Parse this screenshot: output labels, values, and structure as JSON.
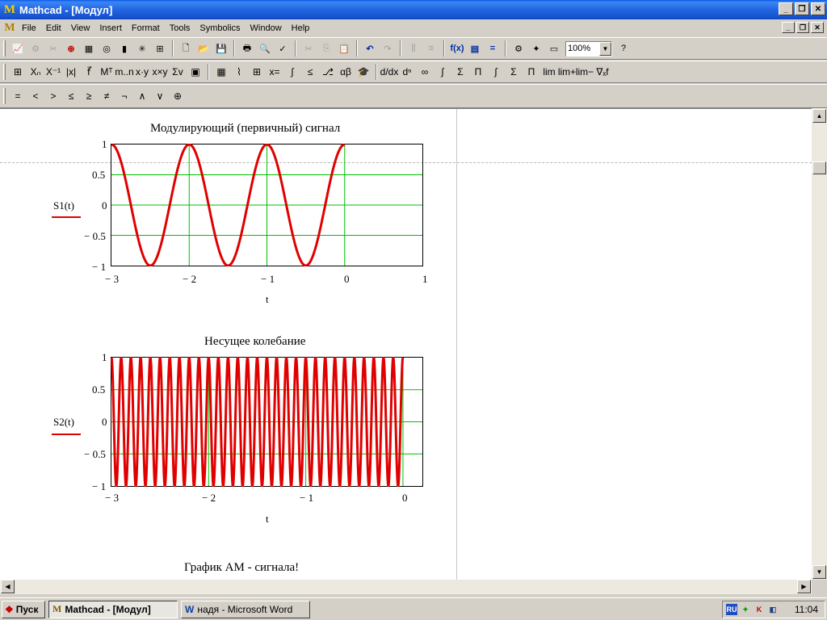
{
  "window": {
    "title": "Mathcad - [Модул]",
    "app_icon": "mathcad-icon",
    "minimize": "_",
    "restore": "❐",
    "close": "✕"
  },
  "menubar": {
    "items": [
      "File",
      "Edit",
      "View",
      "Insert",
      "Format",
      "Tools",
      "Symbolics",
      "Window",
      "Help"
    ]
  },
  "toolbar": {
    "zoom": "100%"
  },
  "boolean_toolbar": {
    "items": [
      "=",
      "<",
      ">",
      "≤",
      "≥",
      "≠",
      "¬",
      "∧",
      "∨",
      "⊕"
    ]
  },
  "plot1": {
    "title": "Модулирующий (первичный) сигнал",
    "ylabel": "S1(t)",
    "xlabel": "t",
    "yticks": [
      "1",
      "0.5",
      "0",
      "− 0.5",
      "− 1"
    ],
    "xticks": [
      "− 3",
      "− 2",
      "− 1",
      "0",
      "1"
    ]
  },
  "plot2": {
    "title": "Несущее колебание",
    "ylabel": "S2(t)",
    "xlabel": "t",
    "yticks": [
      "1",
      "0.5",
      "0",
      "− 0.5",
      "− 1"
    ],
    "xticks": [
      "− 3",
      "− 2",
      "− 1",
      "0"
    ]
  },
  "plot3": {
    "title": "График АМ - сигнала!"
  },
  "chart_data": [
    {
      "type": "line",
      "title": "Модулирующий (первичный) сигнал",
      "xlabel": "t",
      "ylabel": "S1(t)",
      "xlim": [
        -3,
        1
      ],
      "ylim": [
        -1,
        1
      ],
      "grid": true,
      "series": [
        {
          "name": "S1(t)",
          "function": "cos(2*pi*t)",
          "x_range": [
            -3,
            0
          ],
          "color": "#e00000"
        }
      ]
    },
    {
      "type": "line",
      "title": "Несущее колебание",
      "xlabel": "t",
      "ylabel": "S2(t)",
      "xlim": [
        -3,
        0.2
      ],
      "ylim": [
        -1,
        1
      ],
      "grid": true,
      "series": [
        {
          "name": "S2(t)",
          "function": "cos(2*pi*10*t)",
          "x_range": [
            -3,
            0
          ],
          "color": "#e00000"
        }
      ]
    }
  ],
  "taskbar": {
    "start": "Пуск",
    "tasks": [
      "Mathcad - [Модул]",
      "надя - Microsoft Word"
    ],
    "lang": "RU",
    "clock": "11:04"
  },
  "colors": {
    "plot_line": "#e00000",
    "grid": "#00c000",
    "titlebar": "#1552cf"
  }
}
